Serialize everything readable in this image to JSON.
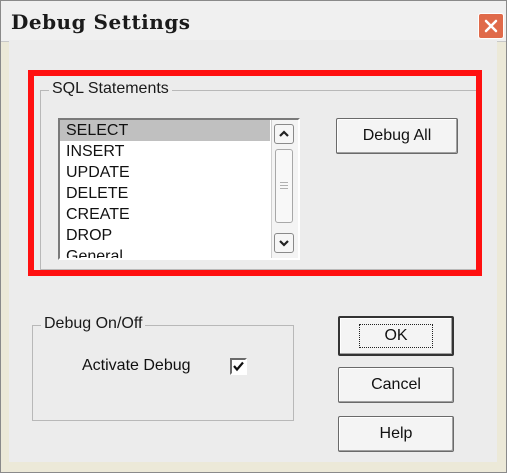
{
  "window": {
    "title": "Debug Settings"
  },
  "sql_group": {
    "legend": "SQL Statements",
    "items": [
      "SELECT",
      "INSERT",
      "UPDATE",
      "DELETE",
      "CREATE",
      "DROP",
      "General"
    ],
    "selected_index": 0
  },
  "buttons": {
    "debug_all": "Debug All",
    "ok": "OK",
    "cancel": "Cancel",
    "help": "Help"
  },
  "debug_group": {
    "legend": "Debug On/Off",
    "activate_label": "Activate Debug",
    "activate_checked": true
  },
  "colors": {
    "highlight_box": "#ff1010",
    "close_button": "#e06a4a"
  },
  "icons": {
    "close": "close-icon",
    "scroll_up": "chevron-up-icon",
    "scroll_down": "chevron-down-icon",
    "check": "checkmark-icon"
  }
}
